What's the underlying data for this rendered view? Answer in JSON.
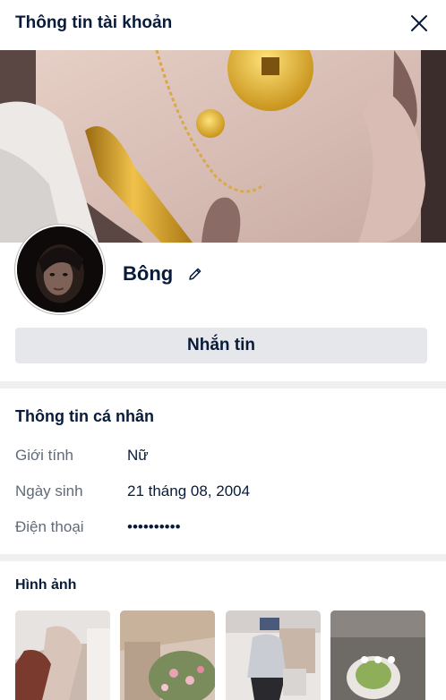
{
  "header": {
    "title": "Thông tin tài khoản",
    "close_icon": "close-icon"
  },
  "profile": {
    "name": "Bông",
    "edit_icon": "pencil-icon"
  },
  "actions": {
    "message_label": "Nhắn tin"
  },
  "personal_info": {
    "title": "Thông tin cá nhân",
    "rows": [
      {
        "label": "Giới tính",
        "value": "Nữ"
      },
      {
        "label": "Ngày sinh",
        "value": "21 tháng 08, 2004"
      },
      {
        "label": "Điện thoại",
        "value": "••••••••••"
      }
    ]
  },
  "photos": {
    "title": "Hình ảnh"
  },
  "colors": {
    "text": "#081b3a",
    "muted": "#5f6b7a",
    "button_bg": "#e5e7eb",
    "divider": "#eef0f2"
  }
}
